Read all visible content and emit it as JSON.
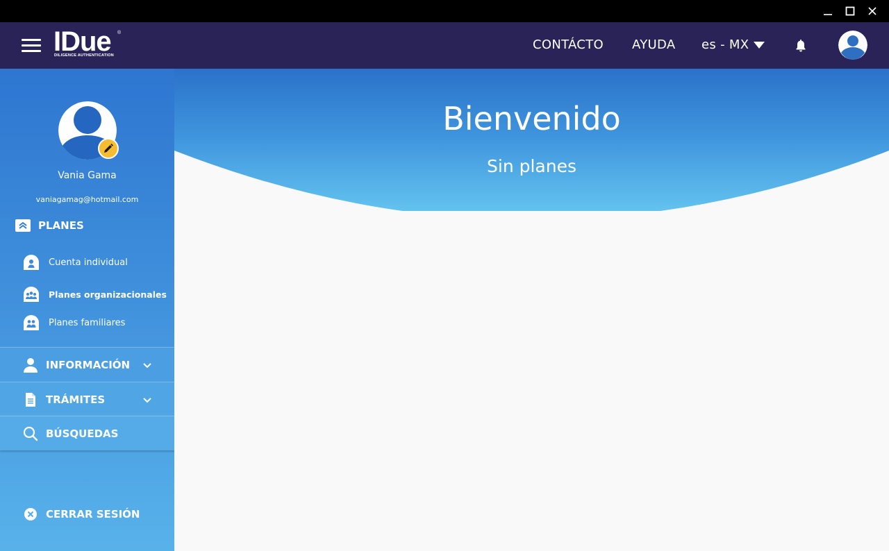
{
  "titlebar": {
    "minimize_icon": "minimize-icon",
    "maximize_icon": "maximize-icon",
    "close_icon": "close-icon"
  },
  "header": {
    "logo_text": "IDue",
    "logo_registered": "®",
    "logo_subtitle": "DILIGENCE AUTHENTICATION",
    "nav": {
      "contacto": "CONTÁCTO",
      "ayuda": "AYUDA",
      "language": "es - MX"
    },
    "background_color": "#2a2358"
  },
  "sidebar": {
    "user": {
      "name": "Vania Gama",
      "email": "vaniagamag@hotmail.com"
    },
    "planes": {
      "label": "PLANES",
      "items": [
        {
          "label": "Cuenta individual",
          "icon": "individual-account-icon"
        },
        {
          "label": "Planes organizacionales",
          "icon": "organization-plans-icon"
        },
        {
          "label": "Planes familiares",
          "icon": "family-plans-icon"
        }
      ]
    },
    "menu": [
      {
        "label": "INFORMACIÓN",
        "icon": "person-icon",
        "expandable": true
      },
      {
        "label": "TRÁMITES",
        "icon": "document-icon",
        "expandable": true
      },
      {
        "label": "BÚSQUEDAS",
        "icon": "search-icon",
        "expandable": false
      }
    ],
    "logout": "CERRAR SESIÓN"
  },
  "main": {
    "title": "Bienvenido",
    "subtitle": "Sin planes"
  },
  "colors": {
    "accent_yellow": "#f5bd2f",
    "banner_top": "#2a72c9",
    "banner_bottom": "#67c8f1"
  }
}
